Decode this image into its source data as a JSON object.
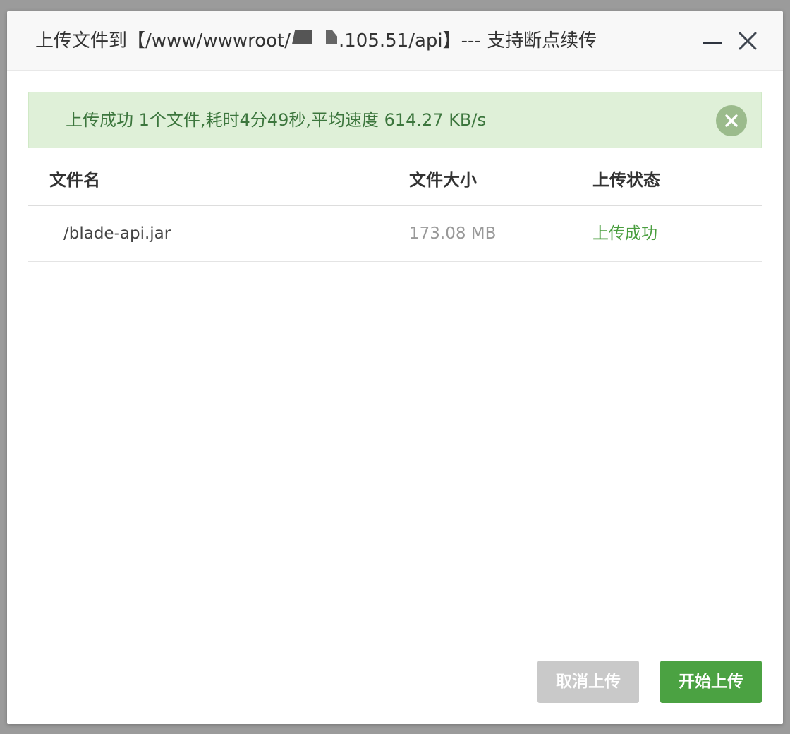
{
  "dialog": {
    "title_prefix": "上传文件到【/www/wwwroot/",
    "title_suffix": ".105.51/api】--- 支持断点续传"
  },
  "alert": {
    "message": "上传成功 1个文件,耗时4分49秒,平均速度 614.27 KB/s"
  },
  "table": {
    "headers": {
      "name": "文件名",
      "size": "文件大小",
      "status": "上传状态"
    },
    "rows": [
      {
        "name": "/blade-api.jar",
        "size": "173.08 MB",
        "status": "上传成功"
      }
    ]
  },
  "buttons": {
    "cancel": "取消上传",
    "start": "开始上传"
  },
  "colors": {
    "success_text": "#3c763d",
    "success_bg": "#dff0d8",
    "status_success": "#4a9e3f",
    "primary_button": "#4ba242",
    "disabled_button": "#c9c9c9"
  },
  "icons": {
    "minimize": "minimize-icon",
    "close": "close-icon",
    "alert_close": "circle-close-icon"
  }
}
